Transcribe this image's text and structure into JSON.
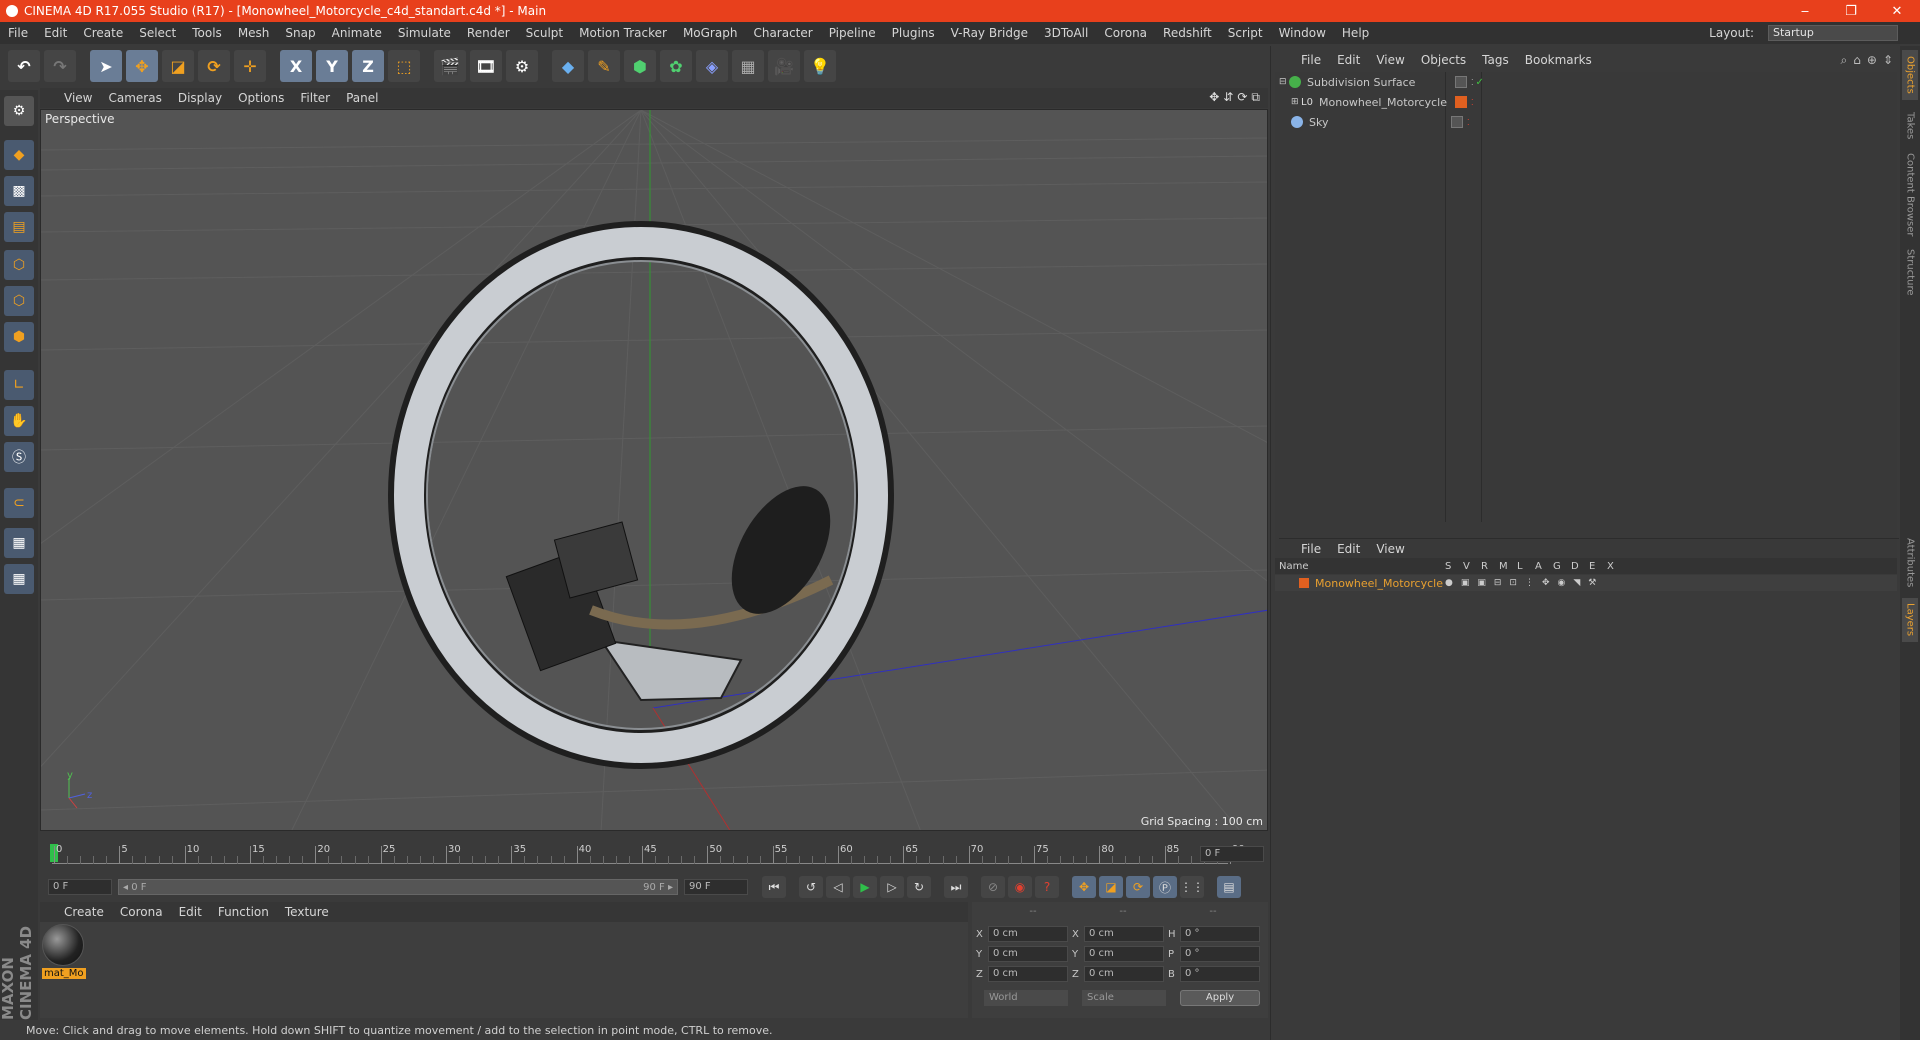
{
  "window": {
    "title": "CINEMA 4D R17.055 Studio (R17) - [Monowheel_Motorcycle_c4d_standart.c4d *] - Main",
    "controls": [
      "‒",
      "❐",
      "✕"
    ]
  },
  "menubar": {
    "items": [
      "File",
      "Edit",
      "Create",
      "Select",
      "Tools",
      "Mesh",
      "Snap",
      "Animate",
      "Simulate",
      "Render",
      "Sculpt",
      "Motion Tracker",
      "MoGraph",
      "Character",
      "Pipeline",
      "Plugins",
      "V-Ray Bridge",
      "3DToAll",
      "Corona",
      "Redshift",
      "Script",
      "Window",
      "Help"
    ],
    "layout_label": "Layout:",
    "layout_value": "Startup"
  },
  "toolbar": {
    "axis_labels": [
      "X",
      "Y",
      "Z"
    ]
  },
  "viewport": {
    "menu": [
      "View",
      "Cameras",
      "Display",
      "Options",
      "Filter",
      "Panel"
    ],
    "label": "Perspective",
    "grid_spacing": "Grid Spacing : 100 cm",
    "axis_labels": [
      "y",
      "z"
    ]
  },
  "timeline": {
    "ticks": [
      "0",
      "5",
      "10",
      "15",
      "20",
      "25",
      "30",
      "35",
      "40",
      "45",
      "50",
      "55",
      "60",
      "65",
      "70",
      "75",
      "80",
      "85",
      "90"
    ],
    "current_frame": "0 F",
    "start_field": "0 F",
    "range_start": "◂ 0 F",
    "range_end": "90 F ▸",
    "end_field": "90 F"
  },
  "materials": {
    "menu": [
      "Create",
      "Corona",
      "Edit",
      "Function",
      "Texture"
    ],
    "items": [
      {
        "label": "mat_Mo"
      }
    ]
  },
  "coordinates": {
    "header": [
      "--",
      "--",
      "--"
    ],
    "rows": [
      {
        "a": "X",
        "av": "0 cm",
        "b": "X",
        "bv": "0 cm",
        "c": "H",
        "cv": "0 °"
      },
      {
        "a": "Y",
        "av": "0 cm",
        "b": "Y",
        "bv": "0 cm",
        "c": "P",
        "cv": "0 °"
      },
      {
        "a": "Z",
        "av": "0 cm",
        "b": "Z",
        "bv": "0 cm",
        "c": "B",
        "cv": "0 °"
      }
    ],
    "world": "World",
    "scale": "Scale",
    "apply": "Apply"
  },
  "status": "Move: Click and drag to move elements. Hold down SHIFT to quantize movement / add to the selection in point mode, CTRL to remove.",
  "objects": {
    "menu": [
      "File",
      "Edit",
      "View",
      "Objects",
      "Tags",
      "Bookmarks"
    ],
    "items": [
      {
        "name": "Subdivision Surface"
      },
      {
        "name": "Monowheel_Motorcycle"
      },
      {
        "name": "Sky"
      }
    ]
  },
  "layers": {
    "menu": [
      "File",
      "Edit",
      "View"
    ],
    "columns": [
      "Name",
      "S",
      "V",
      "R",
      "M",
      "L",
      "A",
      "G",
      "D",
      "E",
      "X"
    ],
    "row": "Monowheel_Motorcycle"
  },
  "side_tabs": [
    "Objects",
    "Takes",
    "Content Browser",
    "Structure",
    "Attributes",
    "Layers"
  ],
  "maxon_logo": "MAXON CINEMA 4D"
}
